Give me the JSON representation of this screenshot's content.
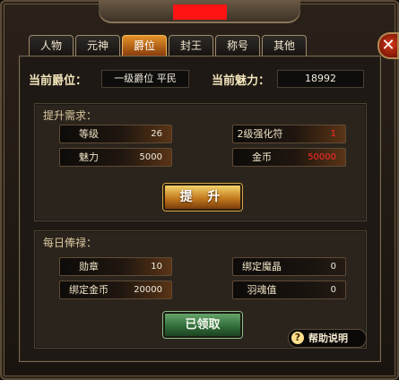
{
  "tabs": [
    "人物",
    "元神",
    "爵位",
    "封王",
    "称号",
    "其他"
  ],
  "active_tab": "爵位",
  "header": {
    "current_rank_label": "当前爵位：",
    "current_rank_value": "一级爵位 平民",
    "current_charm_label": "当前魅力：",
    "current_charm_value": "18992"
  },
  "upgrade": {
    "title": "提升需求：",
    "level_label": "等级",
    "level_value": "26",
    "charm_label": "魅力",
    "charm_value": "5000",
    "rune_label": "2级强化符",
    "rune_value": "1",
    "gold_label": "金币",
    "gold_value": "50000",
    "button_label": "提 升"
  },
  "daily": {
    "title": "每日俸禄：",
    "medal_label": "勋章",
    "medal_value": "10",
    "bound_gold_label": "绑定金币",
    "bound_gold_value": "20000",
    "bound_crystal_label": "绑定魔晶",
    "bound_crystal_value": "0",
    "soul_label": "羽魂值",
    "soul_value": "0",
    "claim_button_label": "已领取"
  },
  "help": {
    "label": "帮助说明",
    "icon": "question-icon"
  },
  "colors": {
    "tab_active": "#e49228",
    "insufficient": "#ff2a2a",
    "claim_button": "#2f6a37",
    "title_bar_marker": "#ff1313"
  }
}
